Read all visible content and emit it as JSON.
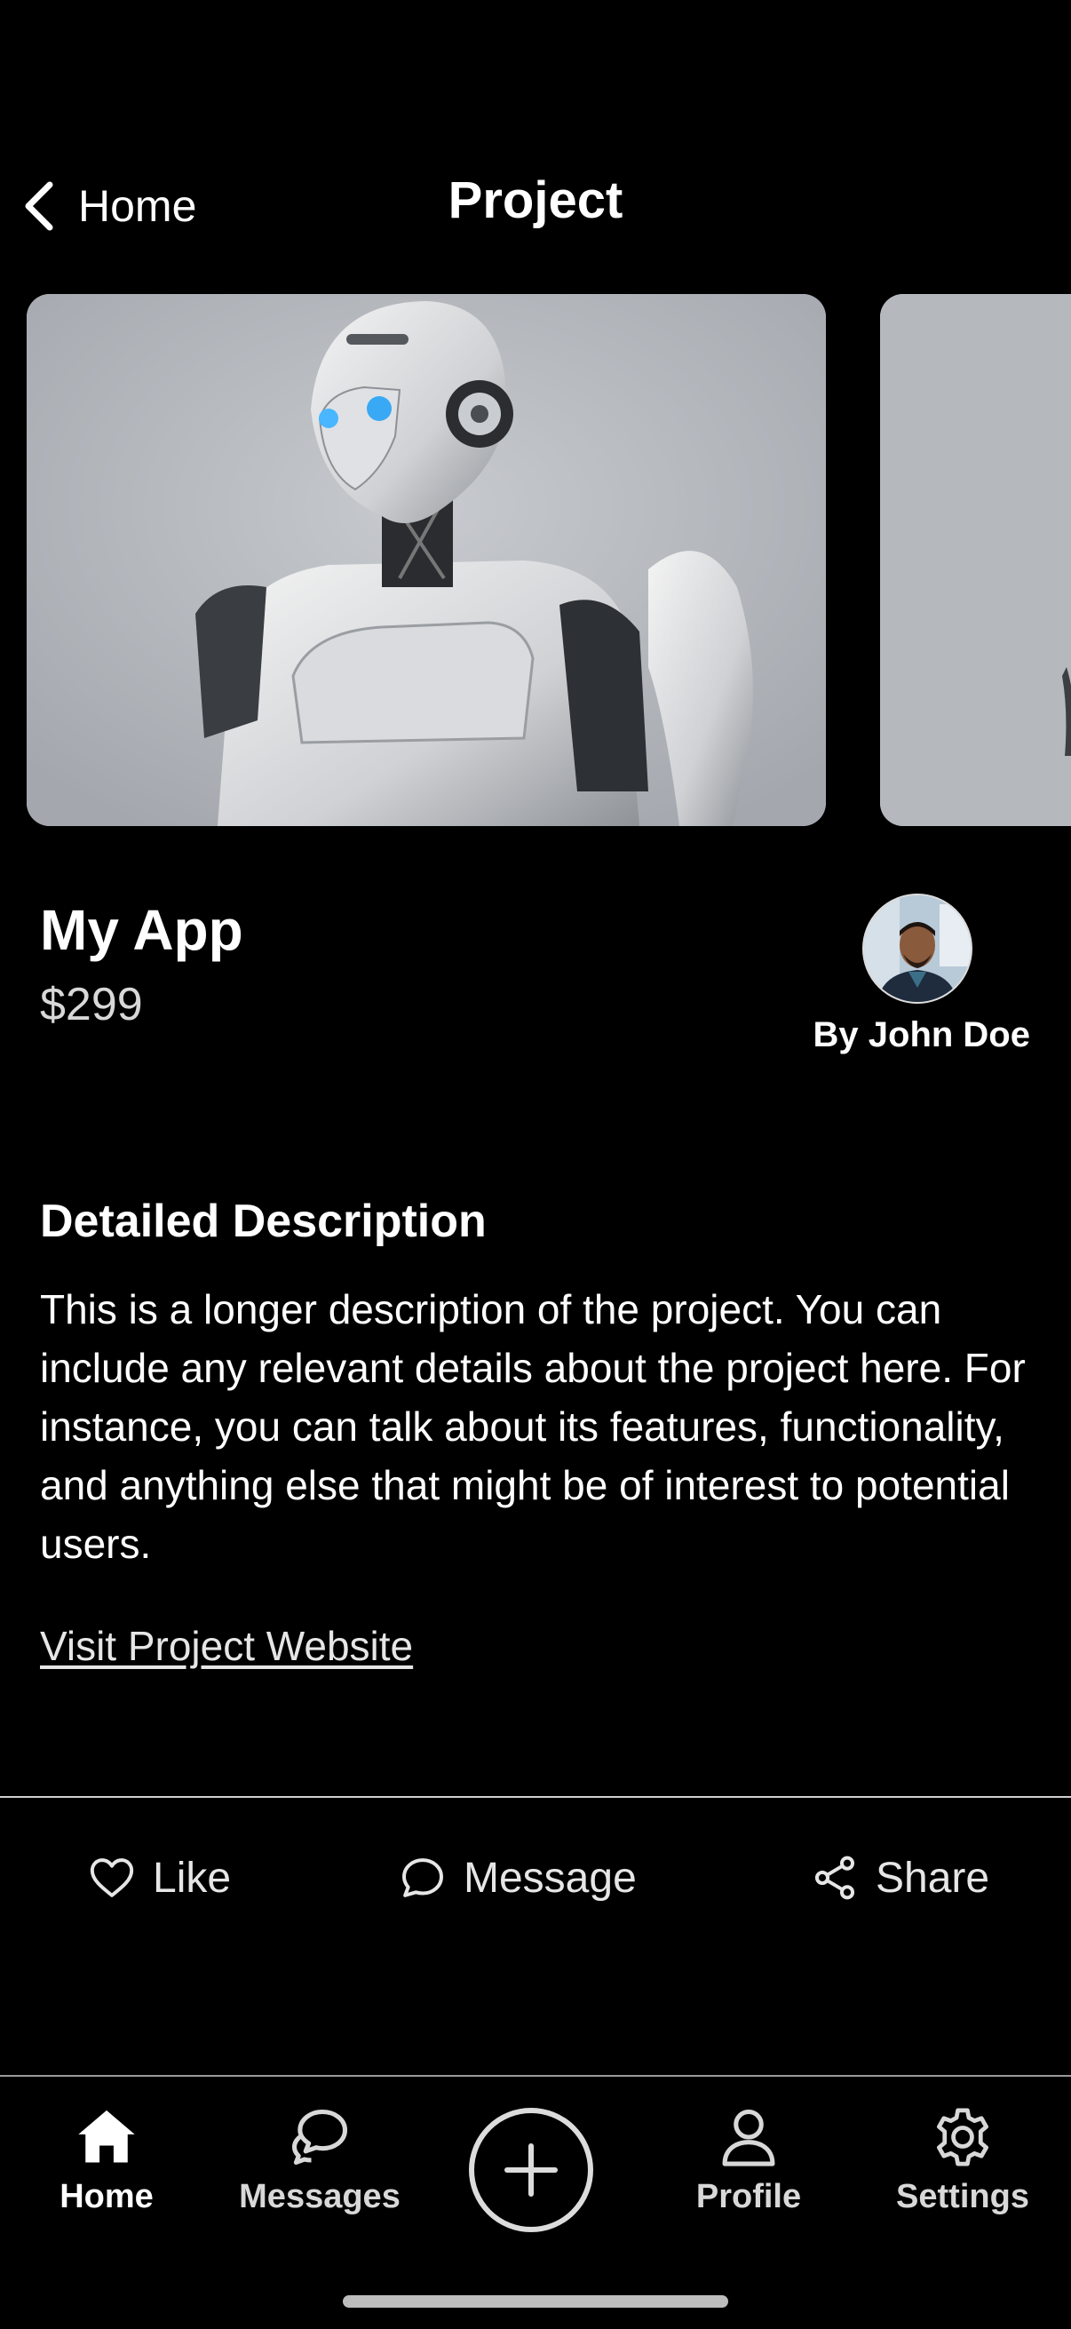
{
  "header": {
    "back_label": "Home",
    "title": "Project"
  },
  "project": {
    "name": "My App",
    "price": "$299",
    "author": "By John Doe"
  },
  "description": {
    "heading": "Detailed Description",
    "body": "This is a longer description of the project. You can include any relevant details about the project here. For instance, you can talk about its features, functionality, and anything else that might be of interest to potential users.",
    "link": "Visit Project Website"
  },
  "actions": {
    "like": "Like",
    "message": "Message",
    "share": "Share"
  },
  "tabbar": {
    "home": "Home",
    "messages": "Messages",
    "profile": "Profile",
    "settings": "Settings"
  },
  "icons": {
    "back": "chevron-left-icon",
    "like": "heart-icon",
    "message": "chat-bubble-icon",
    "share": "share-icon",
    "home": "house-icon",
    "messages": "chat-bubbles-icon",
    "add": "plus-circle-icon",
    "profile": "person-icon",
    "settings": "gear-icon"
  },
  "colors": {
    "background": "#000000",
    "text": "#ffffff",
    "muted": "#d8d8d8"
  }
}
